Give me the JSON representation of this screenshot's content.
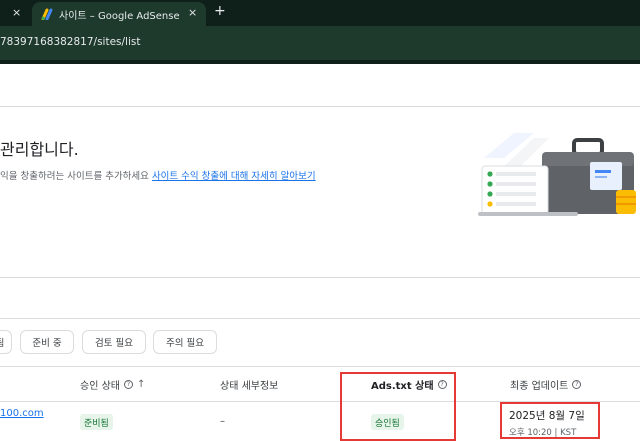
{
  "browser": {
    "prev_tab_close": "×",
    "active_tab_title": "사이트 – Google AdSense",
    "active_tab_close": "×",
    "new_tab": "+",
    "url": "78397168382817/sites/list"
  },
  "intro": {
    "headline": "관리합니다.",
    "description": "익을 창출하려는 사이트를 추가하세요",
    "learn_more_link": "사이트 수익 창출에 대해 자세히 알아보기"
  },
  "filters": {
    "chips": [
      "됨",
      "준비 중",
      "검토 필요",
      "주의 필요"
    ]
  },
  "table": {
    "headers": {
      "approval_status": "승인 상태",
      "status_details": "상태 세부정보",
      "ads_txt_status": "Ads.txt 상태",
      "last_updated": "최종 업데이트"
    },
    "help_glyph": "?",
    "sort_arrow": "↑",
    "row": {
      "site": "100.com",
      "approval_badge": "준비됨",
      "details": "–",
      "ads_txt_badge": "승인됨",
      "date": "2025년 8월 7일",
      "time": "오후 10:20 | KST"
    }
  },
  "colors": {
    "browser_dark": "#0e2019",
    "browser_tab": "#1d3a2c",
    "link": "#1a73e8",
    "badge_bg": "#e6f4ea",
    "badge_text": "#137333",
    "highlight_box": "#e53935"
  },
  "icons": [
    "adsense-logo-icon",
    "close-icon",
    "plus-icon",
    "help-icon",
    "sort-arrow-icon",
    "briefcase-illustration"
  ]
}
